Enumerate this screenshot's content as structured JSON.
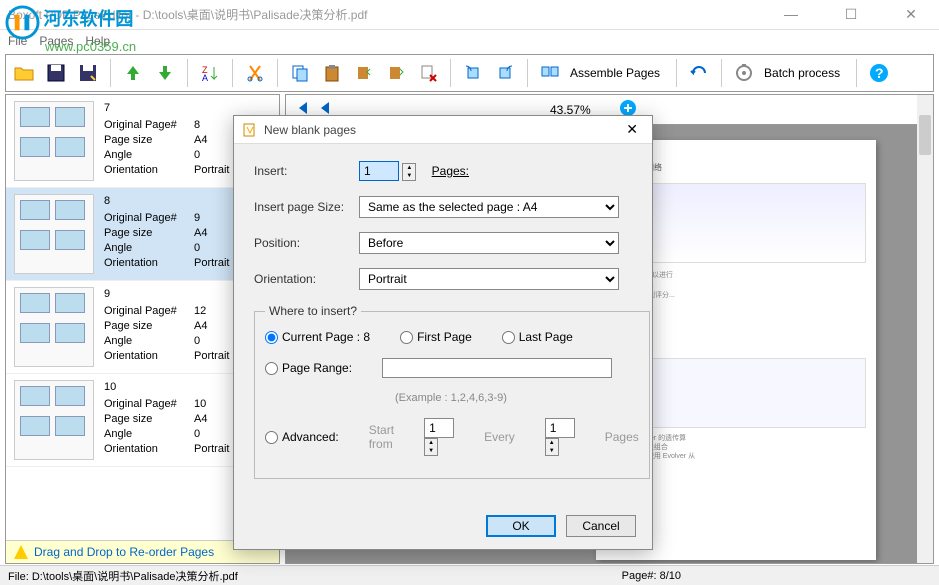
{
  "window": {
    "title": "Boxoft PDF PageEditor - D:\\tools\\桌面\\说明书\\Palisade决策分析.pdf",
    "minimize": "—",
    "maximize": "☐",
    "close": "✕"
  },
  "watermark": {
    "text": "河东软件园",
    "url": "www.pc0359.cn"
  },
  "menu": {
    "file": "File",
    "pages": "Pages",
    "help": "Help"
  },
  "toolbar": {
    "assemble": "Assemble Pages",
    "batch": "Batch process"
  },
  "preview_toolbar": {
    "zoom": "43.57%"
  },
  "pages": [
    {
      "num": "7",
      "orig": "8",
      "size": "A4",
      "angle": "0",
      "orient": "Portrait"
    },
    {
      "num": "8",
      "orig": "9",
      "size": "A4",
      "angle": "0",
      "orient": "Portrait"
    },
    {
      "num": "9",
      "orig": "12",
      "size": "A4",
      "angle": "0",
      "orient": "Portrait"
    },
    {
      "num": "10",
      "orig": "10",
      "size": "A4",
      "angle": "0",
      "orient": "Portrait"
    }
  ],
  "labels": {
    "origpage": "Original Page#",
    "pagesize": "Page size",
    "angle": "Angle",
    "orientation": "Orientation"
  },
  "dragbar": "Drag and Drop to Re-order Pages",
  "dialog": {
    "title": "New blank pages",
    "insert": "Insert:",
    "insert_val": "1",
    "pages": "Pages:",
    "insertsize": "Insert page Size:",
    "size_val": "Same as the selected page : A4",
    "position": "Position:",
    "position_val": "Before",
    "orientation": "Orientation:",
    "orient_val": "Portrait",
    "where": "Where to insert?",
    "current": "Current Page : 8",
    "first": "First Page",
    "last": "Last Page",
    "pagerange": "Page Range:",
    "example": "(Example : 1,2,4,6,3-9)",
    "advanced": "Advanced:",
    "startfrom": "Start from",
    "start_val": "1",
    "every": "Every",
    "every_val": "1",
    "pages2": "Pages",
    "ok": "OK",
    "cancel": "Cancel"
  },
  "status": {
    "file": "File: D:\\tools\\桌面\\说明书\\Palisade决策分析.pdf",
    "page": "Page#: 8/10"
  }
}
